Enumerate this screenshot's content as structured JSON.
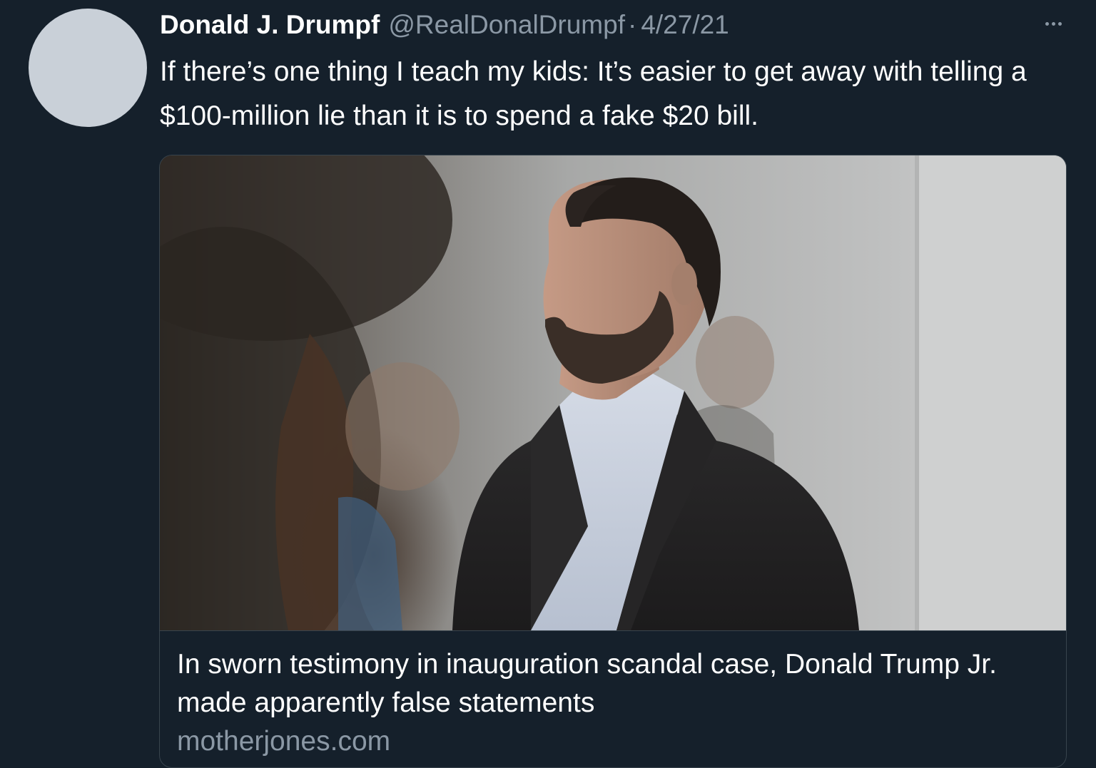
{
  "tweet": {
    "author": {
      "display_name": "Donald J. Drumpf",
      "handle": "@RealDonalDrumpf"
    },
    "separator": "·",
    "date": "4/27/21",
    "more_icon": "more-horizontal-icon",
    "text": "If there’s one thing I teach my kids: It’s easier to get away with telling a $100-million lie than it is to spend a fake $20 bill."
  },
  "link_card": {
    "title": "In sworn testimony in inauguration scandal case, Donald Trump Jr. made apparently false statements",
    "domain": "motherjones.com"
  },
  "colors": {
    "background": "#15202b",
    "text_primary": "#ffffff",
    "text_secondary": "#8b98a5",
    "border": "#38444d",
    "avatar_placeholder": "#c9d0d8"
  }
}
